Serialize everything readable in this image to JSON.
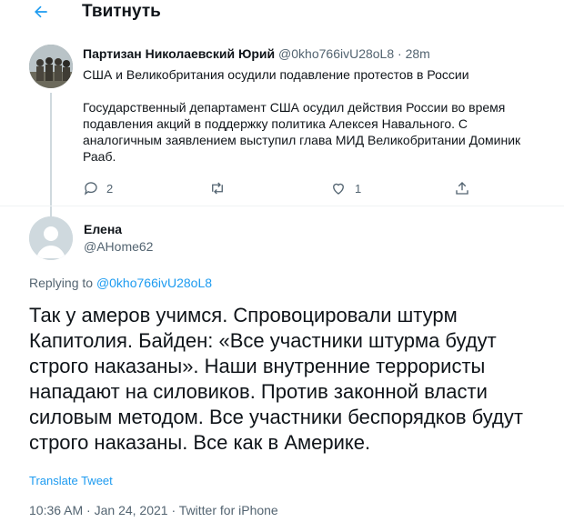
{
  "header": {
    "title": "Твитнуть"
  },
  "parent_tweet": {
    "author_name": "Партизан Николаевский Юрий",
    "handle": "@0kho766ivU28oL8",
    "separator": "·",
    "time": "28m",
    "headline": "США и Великобритания осудили подавление протестов в России",
    "body": "Государственный департамент США осудил действия России во время подавления акций в поддержку политика Алексея Навального. С аналогичным заявлением выступил глава МИД Великобритании Доминик Рааб.",
    "reply_count": "2",
    "retweet_count": "",
    "like_count": "1"
  },
  "reply_tweet": {
    "author_name": "Елена",
    "handle": "@AHome62",
    "replying_prefix": "Replying to",
    "replying_handle": "@0kho766ivU28oL8",
    "text": "Так у амеров учимся. Спровоцировали штурм Капитолия. Байден: «Все участники штурма будут строго наказаны». Наши внутренние террористы нападают на силовиков. Против законной власти силовым методом. Все участники беспорядков будут строго наказаны. Все как в Америке.",
    "translate_label": "Translate Tweet",
    "time": "10:36 AM",
    "date": "Jan 24, 2021",
    "source": "Twitter for iPhone",
    "meta_sep": "·"
  },
  "colors": {
    "accent": "#1d9bf0",
    "text_primary": "#0f1419",
    "text_secondary": "#536471",
    "divider": "#eff3f4"
  },
  "icons": [
    "back-arrow-icon",
    "reply-icon",
    "retweet-icon",
    "like-icon",
    "share-icon",
    "default-avatar-icon"
  ]
}
